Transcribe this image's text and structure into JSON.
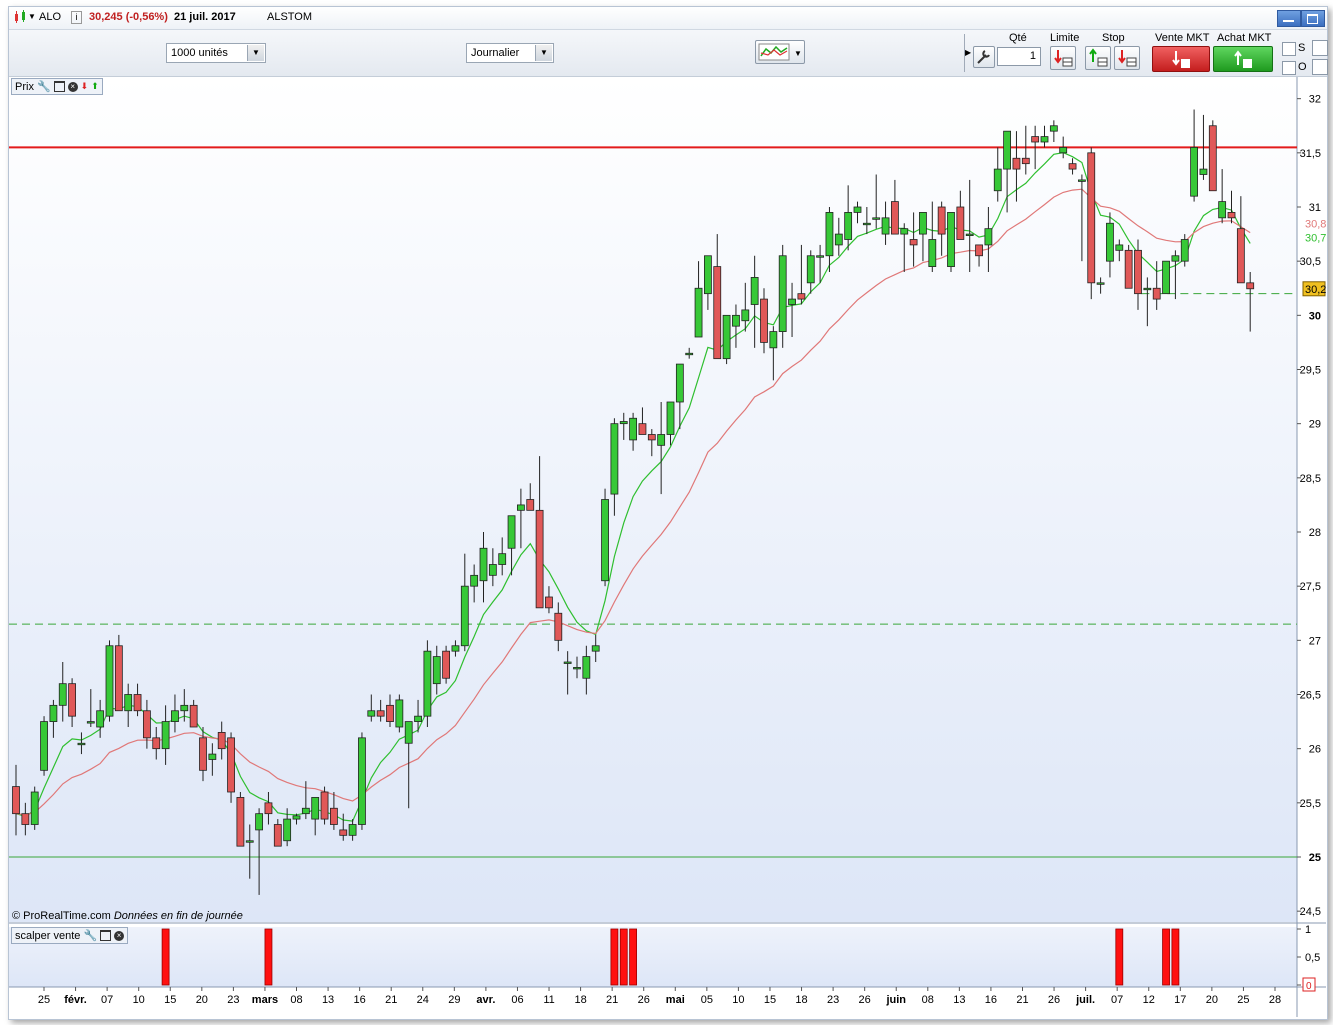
{
  "header": {
    "symbol": "ALO",
    "info_icon": "info-icon",
    "price_change": "30,245 (-0,56%)",
    "date": "21 juil. 2017",
    "name": "ALSTOM"
  },
  "toolbar": {
    "quantity_select": "1000 unités",
    "period_select": "Journalier",
    "qty_label": "Qté",
    "qty_value": "1",
    "limit_label": "Limite",
    "stop_label": "Stop",
    "sell_label": "Vente MKT",
    "buy_label": "Achat MKT",
    "s_label": "S",
    "o_label": "O"
  },
  "price_panel": {
    "label": "Prix",
    "copyright": "© ProRealTime.com",
    "eod_note": "Données en fin de journée"
  },
  "indicator_panel": {
    "label": "scalper vente"
  },
  "colors": {
    "up": "#37c837",
    "down": "#e05858",
    "ma_fast": "#2fbf2f",
    "ma_slow": "#e07878",
    "resistance": "#e31b1b",
    "support_dashed": "#3aa63a",
    "signal_bar": "#ff1010",
    "price_tag": "#f0c020"
  },
  "chart_data": [
    {
      "type": "candlestick",
      "title": "ALSTOM (ALO) - Journalier",
      "y_axis": {
        "ylim": [
          24.4,
          32.2
        ],
        "ticks": [
          "24,5",
          "25",
          "25,5",
          "26",
          "26,5",
          "27",
          "27,5",
          "28",
          "28,5",
          "29",
          "29,5",
          "30",
          "30,5",
          "31",
          "31,5",
          "32"
        ],
        "bold_ticks": [
          "25",
          "30"
        ]
      },
      "x_axis": {
        "tick_labels": [
          "25",
          "févr.",
          "07",
          "10",
          "15",
          "20",
          "23",
          "mars",
          "08",
          "13",
          "16",
          "21",
          "24",
          "29",
          "avr.",
          "06",
          "11",
          "18",
          "21",
          "26",
          "mai",
          "05",
          "10",
          "15",
          "18",
          "23",
          "26",
          "juin",
          "08",
          "13",
          "16",
          "21",
          "26",
          "juil.",
          "07",
          "12",
          "17",
          "20",
          "25",
          "28"
        ],
        "month_labels": [
          "févr.",
          "mars",
          "avr.",
          "mai",
          "juin",
          "juil."
        ]
      },
      "horizontal_lines": [
        {
          "level": 31.55,
          "style": "solid",
          "color": "resistance"
        },
        {
          "level": 27.15,
          "style": "dashed",
          "color": "support_dashed"
        },
        {
          "level": 25.0,
          "style": "solid",
          "color": "support_dashed"
        },
        {
          "level": 30.2,
          "style": "dashed",
          "color": "support_dashed",
          "from_bar": 121
        }
      ],
      "right_labels": [
        {
          "value": 30.85,
          "text": "30,8",
          "color": "ma_slow"
        },
        {
          "value": 30.72,
          "text": "30,7",
          "color": "ma_fast"
        },
        {
          "value": 30.245,
          "text": "30,2",
          "color": "price_tag"
        }
      ],
      "candles_ohlc": [
        [
          25.65,
          25.85,
          25.2,
          25.4
        ],
        [
          25.4,
          25.5,
          25.2,
          25.3
        ],
        [
          25.3,
          25.65,
          25.25,
          25.6
        ],
        [
          25.8,
          26.3,
          25.75,
          26.25
        ],
        [
          26.25,
          26.45,
          26.1,
          26.4
        ],
        [
          26.4,
          26.8,
          26.25,
          26.6
        ],
        [
          26.6,
          26.65,
          26.2,
          26.3
        ],
        [
          26.05,
          26.15,
          25.95,
          26.05
        ],
        [
          26.25,
          26.55,
          26.2,
          26.25
        ],
        [
          26.2,
          26.45,
          26.1,
          26.35
        ],
        [
          26.3,
          27.0,
          26.25,
          26.95
        ],
        [
          26.95,
          27.05,
          26.4,
          26.35
        ],
        [
          26.35,
          26.6,
          26.2,
          26.5
        ],
        [
          26.5,
          26.6,
          26.3,
          26.35
        ],
        [
          26.35,
          26.45,
          26.0,
          26.1
        ],
        [
          26.1,
          26.2,
          25.9,
          26.0
        ],
        [
          26.0,
          26.4,
          25.85,
          26.25
        ],
        [
          26.25,
          26.5,
          26.15,
          26.35
        ],
        [
          26.35,
          26.55,
          26.25,
          26.4
        ],
        [
          26.4,
          26.45,
          26.2,
          26.2
        ],
        [
          26.1,
          26.2,
          25.7,
          25.8
        ],
        [
          25.9,
          26.05,
          25.75,
          25.95
        ],
        [
          26.15,
          26.25,
          25.9,
          26.0
        ],
        [
          26.1,
          26.15,
          25.5,
          25.6
        ],
        [
          25.55,
          25.6,
          25.1,
          25.1
        ],
        [
          25.15,
          25.3,
          24.8,
          25.15
        ],
        [
          25.25,
          25.45,
          24.65,
          25.4
        ],
        [
          25.5,
          25.6,
          25.3,
          25.4
        ],
        [
          25.3,
          25.35,
          25.1,
          25.1
        ],
        [
          25.15,
          25.45,
          25.1,
          25.35
        ],
        [
          25.35,
          25.4,
          25.3,
          25.38
        ],
        [
          25.4,
          25.7,
          25.35,
          25.45
        ],
        [
          25.35,
          25.55,
          25.2,
          25.55
        ],
        [
          25.6,
          25.65,
          25.3,
          25.35
        ],
        [
          25.45,
          25.6,
          25.25,
          25.3
        ],
        [
          25.25,
          25.4,
          25.15,
          25.2
        ],
        [
          25.2,
          25.35,
          25.15,
          25.3
        ],
        [
          25.3,
          26.15,
          25.25,
          26.1
        ],
        [
          26.3,
          26.5,
          26.25,
          26.35
        ],
        [
          26.35,
          26.45,
          26.25,
          26.3
        ],
        [
          26.4,
          26.5,
          26.2,
          26.25
        ],
        [
          26.2,
          26.5,
          26.15,
          26.45
        ],
        [
          26.05,
          26.25,
          25.45,
          26.25
        ],
        [
          26.25,
          26.45,
          26.15,
          26.3
        ],
        [
          26.3,
          27.0,
          26.2,
          26.9
        ],
        [
          26.6,
          26.95,
          26.5,
          26.85
        ],
        [
          26.9,
          26.95,
          26.6,
          26.65
        ],
        [
          26.9,
          27.0,
          26.85,
          26.95
        ],
        [
          26.95,
          27.8,
          26.9,
          27.5
        ],
        [
          27.5,
          27.7,
          27.35,
          27.6
        ],
        [
          27.55,
          28.0,
          27.35,
          27.85
        ],
        [
          27.6,
          27.85,
          27.5,
          27.7
        ],
        [
          27.7,
          27.95,
          27.6,
          27.8
        ],
        [
          27.85,
          28.15,
          27.6,
          28.15
        ],
        [
          28.2,
          28.4,
          27.85,
          28.25
        ],
        [
          28.3,
          28.45,
          28.2,
          28.2
        ],
        [
          28.2,
          28.7,
          27.4,
          27.3
        ],
        [
          27.4,
          27.5,
          27.25,
          27.3
        ],
        [
          27.25,
          27.35,
          26.9,
          27.0
        ],
        [
          26.8,
          26.9,
          26.5,
          26.8
        ],
        [
          26.75,
          26.85,
          26.65,
          26.75
        ],
        [
          26.65,
          26.95,
          26.5,
          26.85
        ],
        [
          26.9,
          27.05,
          26.8,
          26.95
        ],
        [
          27.55,
          28.4,
          27.5,
          28.3
        ],
        [
          28.35,
          29.05,
          28.15,
          29.0
        ],
        [
          29.0,
          29.1,
          28.85,
          29.02
        ],
        [
          28.85,
          29.1,
          28.75,
          29.05
        ],
        [
          29.0,
          29.15,
          28.9,
          28.9
        ],
        [
          28.9,
          28.95,
          28.7,
          28.85
        ],
        [
          28.8,
          29.2,
          28.35,
          28.9
        ],
        [
          28.9,
          29.2,
          28.8,
          29.2
        ],
        [
          29.2,
          29.55,
          28.95,
          29.55
        ],
        [
          29.65,
          29.7,
          29.6,
          29.65
        ],
        [
          29.8,
          30.5,
          29.8,
          30.25
        ],
        [
          30.2,
          30.5,
          30.05,
          30.55
        ],
        [
          30.45,
          30.75,
          30.1,
          29.6
        ],
        [
          29.6,
          30.0,
          29.55,
          30.0
        ],
        [
          29.9,
          30.1,
          29.7,
          30.0
        ],
        [
          29.95,
          30.3,
          29.85,
          30.05
        ],
        [
          30.1,
          30.55,
          29.7,
          30.35
        ],
        [
          30.15,
          30.25,
          29.65,
          29.75
        ],
        [
          29.7,
          29.9,
          29.4,
          29.85
        ],
        [
          29.85,
          30.65,
          29.7,
          30.55
        ],
        [
          30.1,
          30.3,
          29.8,
          30.15
        ],
        [
          30.2,
          30.65,
          30.1,
          30.15
        ],
        [
          30.3,
          30.6,
          30.2,
          30.55
        ],
        [
          30.55,
          30.65,
          30.3,
          30.55
        ],
        [
          30.55,
          31.0,
          30.4,
          30.95
        ],
        [
          30.65,
          30.9,
          30.55,
          30.75
        ],
        [
          30.7,
          31.2,
          30.6,
          30.95
        ],
        [
          30.95,
          31.05,
          30.85,
          31.0
        ],
        [
          30.85,
          31.0,
          30.75,
          30.85
        ],
        [
          30.9,
          31.3,
          30.8,
          30.9
        ],
        [
          30.75,
          31.05,
          30.65,
          30.9
        ],
        [
          31.05,
          31.25,
          30.75,
          30.75
        ],
        [
          30.75,
          30.85,
          30.4,
          30.8
        ],
        [
          30.7,
          30.95,
          30.45,
          30.65
        ],
        [
          30.75,
          30.95,
          30.5,
          30.95
        ],
        [
          30.45,
          31.05,
          30.4,
          30.7
        ],
        [
          31.0,
          31.05,
          30.55,
          30.75
        ],
        [
          30.45,
          30.75,
          30.4,
          30.95
        ],
        [
          31.0,
          31.15,
          30.8,
          30.7
        ],
        [
          30.75,
          31.25,
          30.4,
          30.75
        ],
        [
          30.65,
          30.55,
          30.45,
          30.55
        ],
        [
          30.65,
          31.0,
          30.4,
          30.8
        ],
        [
          31.15,
          31.55,
          31.05,
          31.35
        ],
        [
          31.35,
          31.65,
          30.95,
          31.7
        ],
        [
          31.45,
          31.7,
          31.05,
          31.35
        ],
        [
          31.45,
          31.75,
          31.3,
          31.4
        ],
        [
          31.65,
          31.75,
          31.35,
          31.6
        ],
        [
          31.6,
          31.75,
          31.55,
          31.65
        ],
        [
          31.7,
          31.8,
          31.6,
          31.75
        ],
        [
          31.5,
          31.65,
          31.45,
          31.55
        ],
        [
          31.4,
          31.45,
          31.3,
          31.35
        ],
        [
          31.25,
          31.3,
          30.5,
          31.25
        ],
        [
          31.5,
          31.55,
          30.15,
          30.3
        ],
        [
          30.3,
          30.35,
          30.2,
          30.3
        ],
        [
          30.5,
          30.95,
          30.35,
          30.85
        ],
        [
          30.6,
          30.7,
          30.5,
          30.65
        ],
        [
          30.6,
          30.65,
          30.25,
          30.25
        ],
        [
          30.6,
          30.7,
          30.05,
          30.2
        ],
        [
          30.25,
          30.35,
          29.9,
          30.25
        ],
        [
          30.25,
          30.5,
          30.05,
          30.15
        ],
        [
          30.2,
          30.5,
          30.2,
          30.5
        ],
        [
          30.5,
          30.6,
          30.15,
          30.55
        ],
        [
          30.5,
          30.75,
          30.45,
          30.7
        ],
        [
          31.1,
          31.9,
          31.05,
          31.55
        ],
        [
          31.3,
          31.85,
          31.25,
          31.35
        ],
        [
          31.75,
          31.8,
          31.25,
          31.15
        ],
        [
          30.9,
          31.35,
          30.85,
          31.05
        ],
        [
          30.95,
          31.15,
          30.85,
          30.9
        ],
        [
          30.8,
          31.1,
          30.3,
          30.3
        ],
        [
          30.3,
          30.4,
          29.85,
          30.245
        ]
      ]
    },
    {
      "type": "bar",
      "title": "scalper vente",
      "y_axis": {
        "ylim": [
          0,
          1
        ],
        "ticks": [
          "0",
          "0,5",
          "1"
        ]
      },
      "signal_bars_at_candle_index": [
        16,
        27,
        64,
        65,
        66,
        118,
        123,
        124
      ],
      "values": [
        1,
        1,
        1,
        1,
        1,
        1,
        1,
        1
      ],
      "last_value_label": "0"
    }
  ]
}
